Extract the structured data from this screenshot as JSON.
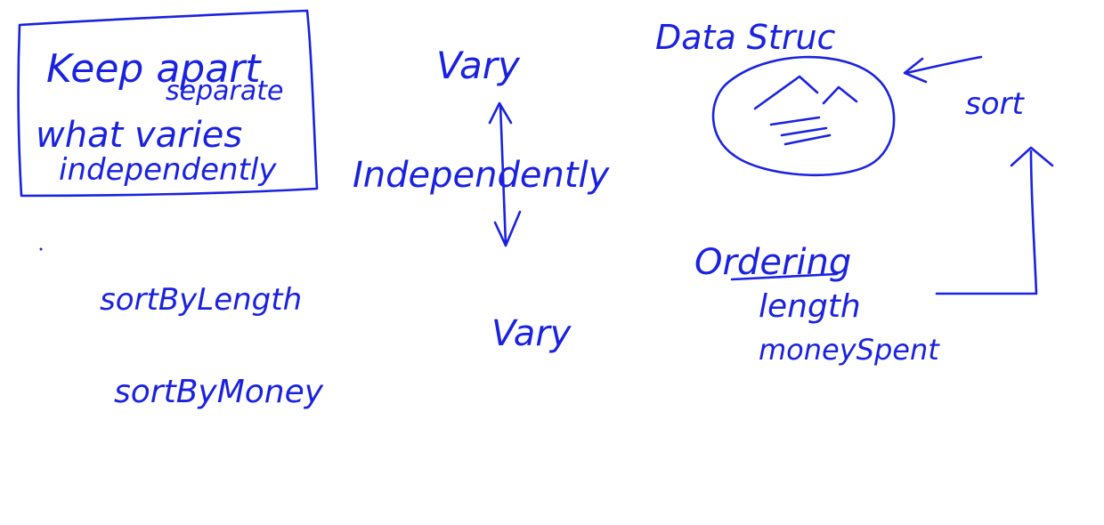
{
  "ink_color": "#1a22e0",
  "background_color": "#ffffff",
  "notes": {
    "box_line1": "Keep apart",
    "box_line1b": "separate",
    "box_line2": "what varies",
    "box_line3": "independently",
    "vary_top": "Vary",
    "independently": "Independently",
    "vary_bottom": "Vary",
    "sort_by_length": "sortByLength",
    "sort_by_money": "sortByMoney",
    "data_structure": "Data Struc",
    "sort": "sort",
    "ordering": "Ordering",
    "length": "length",
    "money_spent": "moneySpent"
  }
}
